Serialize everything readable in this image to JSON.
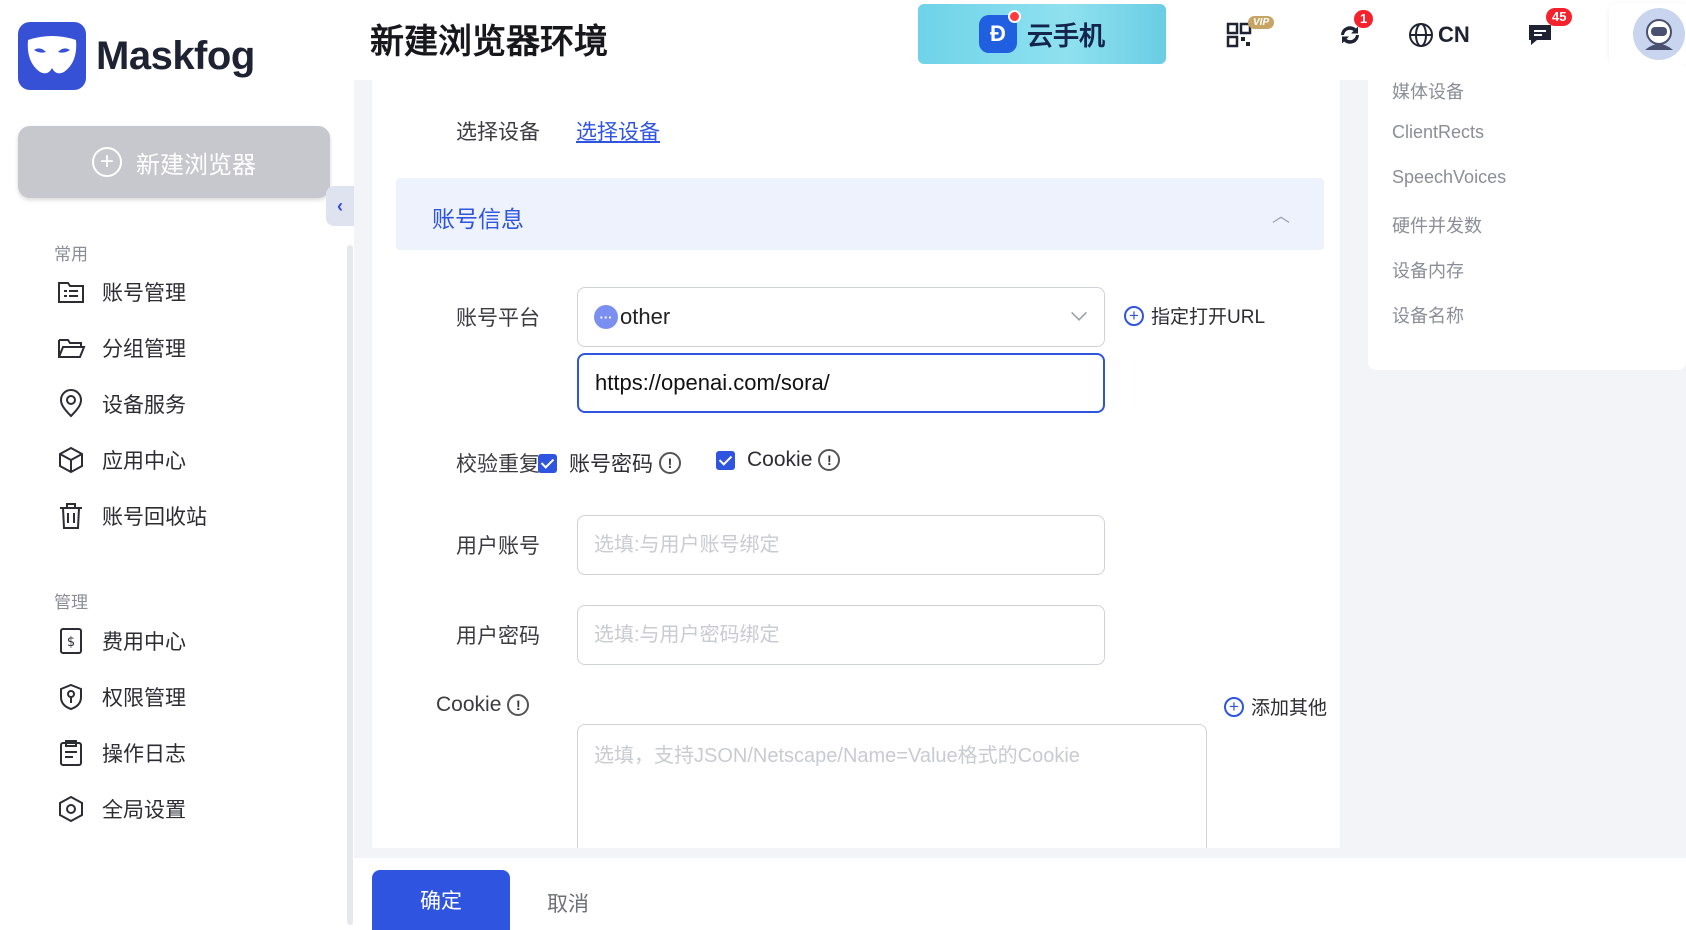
{
  "app": {
    "name": "Maskfog",
    "brand_color": "#3651d6"
  },
  "sidebar": {
    "new_browser_label": "新建浏览器",
    "sections": [
      {
        "label": "常用",
        "items": [
          {
            "label": "账号管理",
            "icon": "list-folder-icon"
          },
          {
            "label": "分组管理",
            "icon": "open-folder-icon"
          },
          {
            "label": "设备服务",
            "icon": "location-pin-icon"
          },
          {
            "label": "应用中心",
            "icon": "cube-icon"
          },
          {
            "label": "账号回收站",
            "icon": "trash-icon"
          }
        ]
      },
      {
        "label": "管理",
        "items": [
          {
            "label": "费用中心",
            "icon": "dollar-receipt-icon"
          },
          {
            "label": "权限管理",
            "icon": "shield-key-icon"
          },
          {
            "label": "操作日志",
            "icon": "clipboard-icon"
          },
          {
            "label": "全局设置",
            "icon": "hex-settings-icon"
          }
        ]
      }
    ]
  },
  "header": {
    "title": "新建浏览器环境",
    "banner_text": "云手机",
    "vip_label": "VIP",
    "sync_badge": "1",
    "language": "CN",
    "messages_badge": "45"
  },
  "form": {
    "device_label": "选择设备",
    "device_link": "选择设备",
    "section_title": "账号信息",
    "platform_label": "账号平台",
    "platform_value": "other",
    "open_url_label": "指定打开URL",
    "url_value": "https://openai.com/sora/",
    "verify_label": "校验重复",
    "verify_options": [
      {
        "label": "账号密码",
        "checked": true
      },
      {
        "label": "Cookie",
        "checked": true
      }
    ],
    "user_account_label": "用户账号",
    "user_account_placeholder": "选填:与用户账号绑定",
    "user_password_label": "用户密码",
    "user_password_placeholder": "选填:与用户密码绑定",
    "cookie_label": "Cookie",
    "cookie_placeholder": "选填，支持JSON/Netscape/Name=Value格式的Cookie",
    "add_other_label": "添加其他"
  },
  "right_panel": {
    "items": [
      "媒体设备",
      "ClientRects",
      "SpeechVoices",
      "硬件并发数",
      "设备内存",
      "设备名称"
    ]
  },
  "footer": {
    "confirm_label": "确定",
    "cancel_label": "取消"
  }
}
